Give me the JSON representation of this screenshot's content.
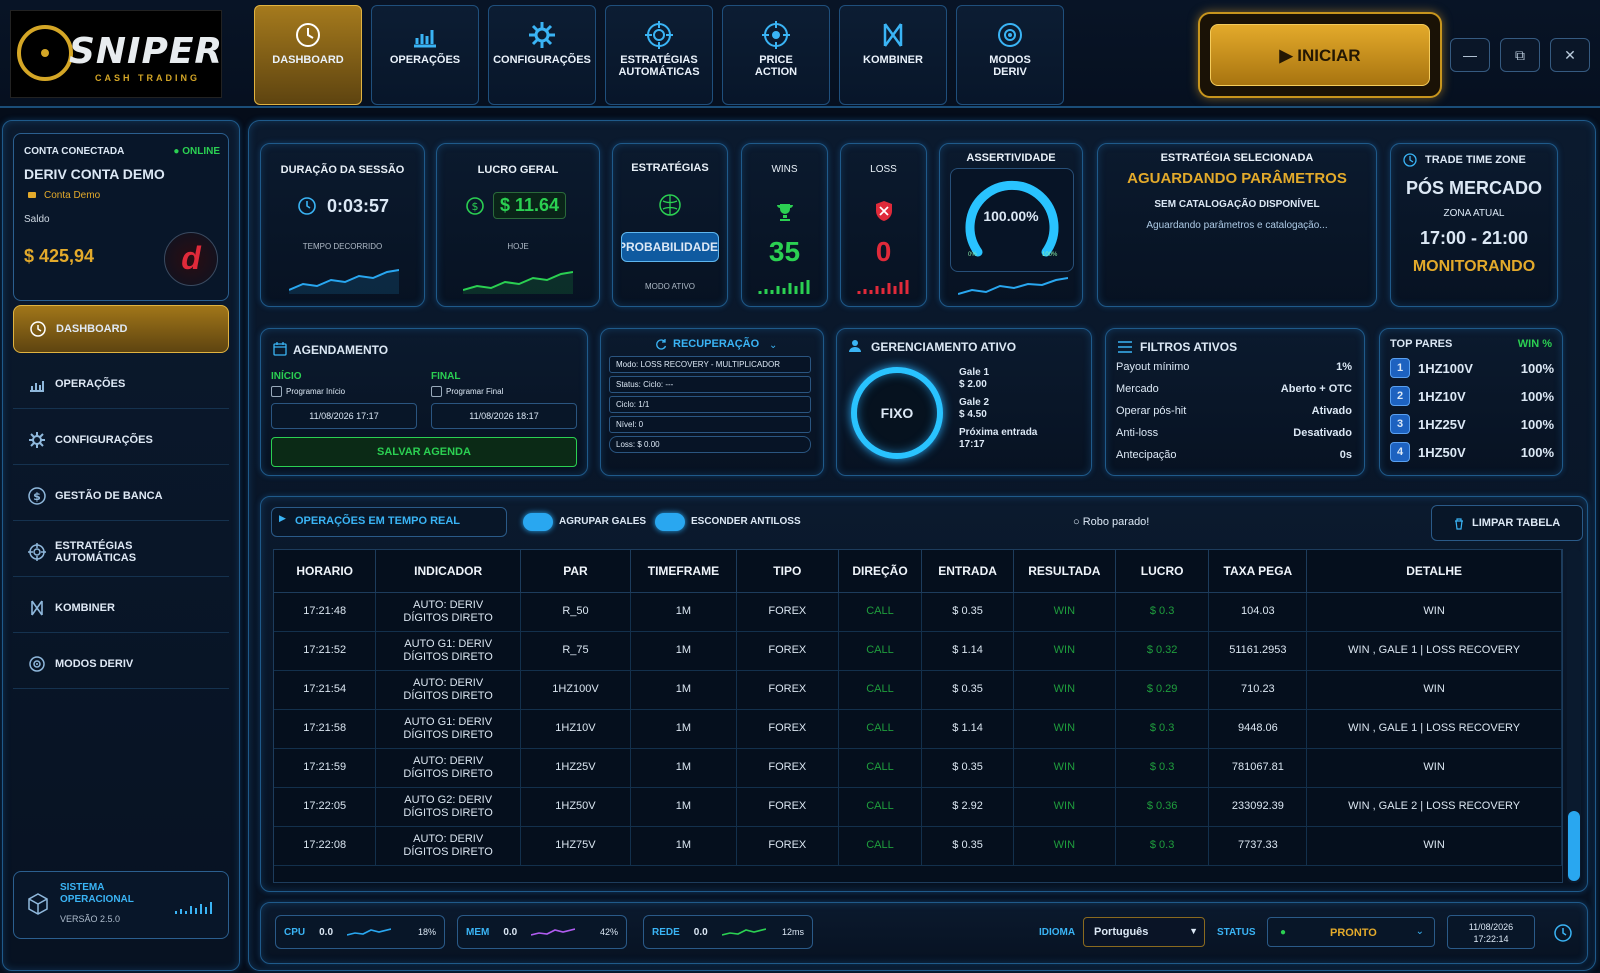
{
  "brand": {
    "name": "SNIPER",
    "tagline": "CASH TRADING"
  },
  "tabs": [
    {
      "label": "DASHBOARD",
      "icon": "clock-icon"
    },
    {
      "label": "OPERAÇÕES",
      "icon": "bar-chart-icon"
    },
    {
      "label": "CONFIGURAÇÕES",
      "icon": "gear-icon"
    },
    {
      "label": "ESTRATÉGIAS AUTOMÁTICAS",
      "icon": "target-icon"
    },
    {
      "label": "PRICE ACTION",
      "icon": "target-icon"
    },
    {
      "label": "KOMBINER",
      "icon": "kombiner-icon"
    },
    {
      "label": "MODOS DERIV",
      "icon": "target-icon"
    }
  ],
  "start_button": "▶ INICIAR",
  "window_controls": {
    "minimize": "—",
    "restore": "⧉",
    "close": "✕"
  },
  "account": {
    "title": "CONTA CONECTADA",
    "status": "● ONLINE",
    "name": "DERIV CONTA DEMO",
    "type": "Conta Demo",
    "balance_label": "Saldo",
    "balance": "$ 425,94",
    "logo": "d"
  },
  "sidebar": [
    {
      "label": "DASHBOARD"
    },
    {
      "label": "OPERAÇÕES"
    },
    {
      "label": "CONFIGURAÇÕES"
    },
    {
      "label": "GESTÃO DE BANCA"
    },
    {
      "label": "ESTRATÉGIAS AUTOMÁTICAS"
    },
    {
      "label": "KOMBINER"
    },
    {
      "label": "MODOS DERIV"
    }
  ],
  "system": {
    "title": "SISTEMA OPERACIONAL",
    "version": "VERSÃO 2.5.0"
  },
  "stats": {
    "session": {
      "title": "DURAÇÃO DA SESSÃO",
      "value": "0:03:57",
      "sub": "TEMPO DECORRIDO"
    },
    "profit": {
      "title": "LUCRO GERAL",
      "value": "$ 11.64",
      "sub": "HOJE"
    },
    "strategies": {
      "title": "ESTRATÉGIAS",
      "value": "PROBABILIDADE",
      "sub": "MODO ATIVO"
    },
    "wins": {
      "title": "WINS",
      "value": "35"
    },
    "loss": {
      "title": "LOSS",
      "value": "0"
    },
    "accuracy": {
      "title": "ASSERTIVIDADE",
      "value": "100.00%",
      "min": "0%",
      "max": "100%",
      "percent": 100
    },
    "strategy_sel": {
      "title": "ESTRATÉGIA SELECIONADA",
      "value": "AGUARDANDO PARÂMETROS",
      "sub": "SEM CATALOGAÇÃO DISPONÍVEL",
      "note": "Aguardando parâmetros e catalogação..."
    },
    "timezone": {
      "title": "TRADE TIME ZONE",
      "value": "PÓS MERCADO",
      "zone_label": "ZONA ATUAL",
      "range": "17:00 - 21:00",
      "status": "MONITORANDO"
    }
  },
  "schedule": {
    "title": "AGENDAMENTO",
    "start_label": "INÍCIO",
    "start_check": "Programar Início",
    "start_date": "11/08/2026 17:17",
    "end_label": "FINAL",
    "end_check": "Programar Final",
    "end_date": "11/08/2026 18:17",
    "save": "SALVAR AGENDA"
  },
  "recovery": {
    "title": "RECUPERAÇÃO",
    "rows": [
      "Modo: LOSS RECOVERY - MULTIPLICADOR",
      "Status: Ciclo: ---",
      "Ciclo: 1/1",
      "Nível: 0",
      "Loss: $ 0.00"
    ]
  },
  "management": {
    "title": "GERENCIAMENTO ATIVO",
    "mode": "FIXO",
    "gale1_label": "Gale 1",
    "gale1": "$ 2.00",
    "gale2_label": "Gale 2",
    "gale2": "$ 4.50",
    "next_label": "Próxima entrada",
    "next": "17:17"
  },
  "filters": {
    "title": "FILTROS ATIVOS",
    "rows": [
      {
        "k": "Payout mínimo",
        "v": "1%"
      },
      {
        "k": "Mercado",
        "v": "Aberto + OTC"
      },
      {
        "k": "Operar pós-hit",
        "v": "Ativado"
      },
      {
        "k": "Anti-loss",
        "v": "Desativado"
      },
      {
        "k": "Antecipação",
        "v": "0s"
      }
    ]
  },
  "top_pairs": {
    "title": "TOP PARES",
    "col": "WIN %",
    "rows": [
      {
        "n": "1",
        "pair": "1HZ100V",
        "pct": "100%"
      },
      {
        "n": "2",
        "pair": "1HZ10V",
        "pct": "100%"
      },
      {
        "n": "3",
        "pair": "1HZ25V",
        "pct": "100%"
      },
      {
        "n": "4",
        "pair": "1HZ50V",
        "pct": "100%"
      }
    ]
  },
  "ops": {
    "title": "OPERAÇÕES EM TEMPO REAL",
    "group_gales": "AGRUPAR GALES",
    "hide_antiloss": "ESCONDER ANTILOSS",
    "robot_status": "○ Robo parado!",
    "clear": "LIMPAR TABELA",
    "headers": [
      "HORARIO",
      "INDICADOR",
      "PAR",
      "TIMEFRAME",
      "TIPO",
      "DIREÇÃO",
      "ENTRADA",
      "RESULTADA",
      "LUCRO",
      "TAXA PEGA",
      "DETALHE"
    ],
    "rows": [
      [
        "17:21:48",
        "AUTO: DERIV DÍGITOS DIRETO",
        "R_50",
        "1M",
        "FOREX",
        "CALL",
        "$ 0.35",
        "WIN",
        "$ 0.3",
        "104.03",
        "WIN"
      ],
      [
        "17:21:52",
        "AUTO G1: DERIV DÍGITOS DIRETO",
        "R_75",
        "1M",
        "FOREX",
        "CALL",
        "$ 1.14",
        "WIN",
        "$ 0.32",
        "51161.2953",
        "WIN , GALE 1 | LOSS RECOVERY"
      ],
      [
        "17:21:54",
        "AUTO: DERIV DÍGITOS DIRETO",
        "1HZ100V",
        "1M",
        "FOREX",
        "CALL",
        "$ 0.35",
        "WIN",
        "$ 0.29",
        "710.23",
        "WIN"
      ],
      [
        "17:21:58",
        "AUTO G1: DERIV DÍGITOS DIRETO",
        "1HZ10V",
        "1M",
        "FOREX",
        "CALL",
        "$ 1.14",
        "WIN",
        "$ 0.3",
        "9448.06",
        "WIN , GALE 1 | LOSS RECOVERY"
      ],
      [
        "17:21:59",
        "AUTO: DERIV DÍGITOS DIRETO",
        "1HZ25V",
        "1M",
        "FOREX",
        "CALL",
        "$ 0.35",
        "WIN",
        "$ 0.3",
        "781067.81",
        "WIN"
      ],
      [
        "17:22:05",
        "AUTO G2: DERIV DÍGITOS DIRETO",
        "1HZ50V",
        "1M",
        "FOREX",
        "CALL",
        "$ 2.92",
        "WIN",
        "$ 0.36",
        "233092.39",
        "WIN , GALE 2 | LOSS RECOVERY"
      ],
      [
        "17:22:08",
        "AUTO: DERIV DÍGITOS DIRETO",
        "1HZ75V",
        "1M",
        "FOREX",
        "CALL",
        "$ 0.35",
        "WIN",
        "$ 0.3",
        "7737.33",
        "WIN"
      ]
    ]
  },
  "footer": {
    "cpu_label": "CPU",
    "cpu_val": "0.0",
    "cpu_pct": "18%",
    "mem_label": "MEM",
    "mem_val": "0.0",
    "mem_pct": "42%",
    "net_label": "REDE",
    "net_val": "0.0",
    "net_ms": "12ms",
    "lang_label": "IDIOMA",
    "lang": "Português",
    "status_label": "STATUS",
    "status": "PRONTO",
    "date": "11/08/2026",
    "time": "17:22:14"
  },
  "colors": {
    "gold": "#e3aa2b",
    "cyan": "#29a7f0",
    "green": "#2bd052",
    "red": "#e02a3a"
  }
}
